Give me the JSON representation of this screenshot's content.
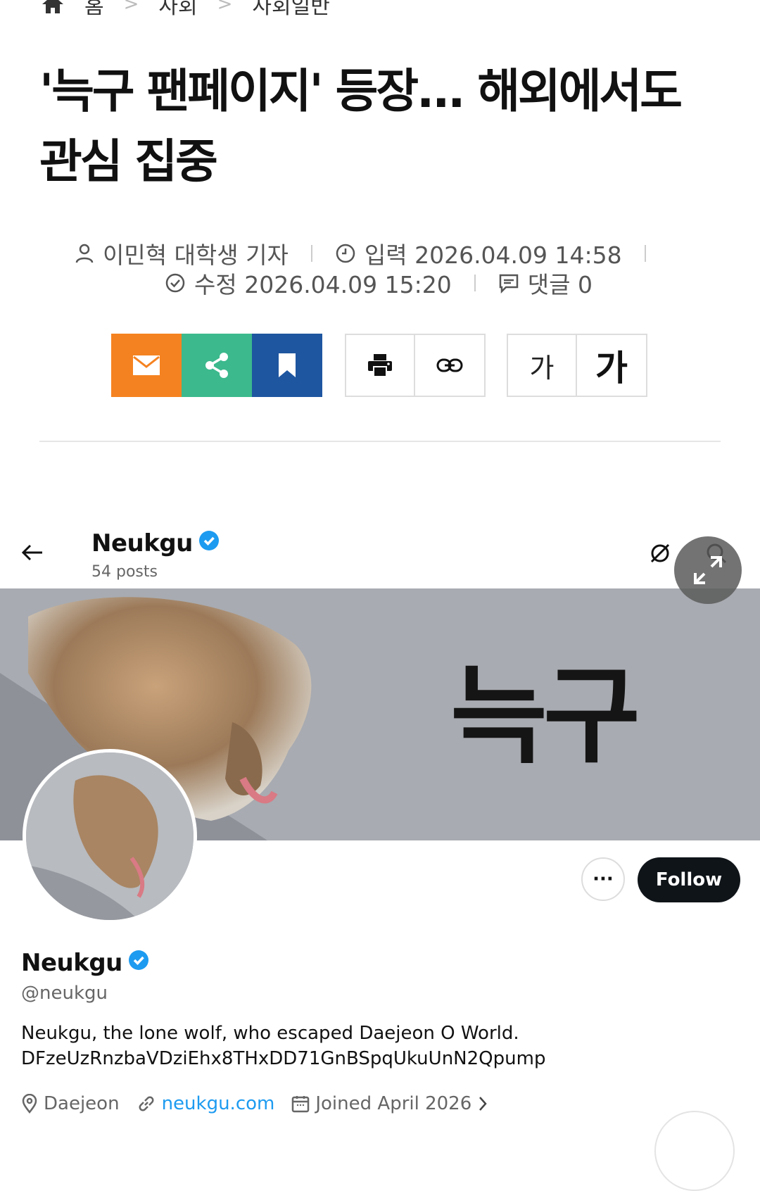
{
  "breadcrumb": {
    "home": "홈",
    "section": "사회",
    "subsection": "사회일반"
  },
  "article": {
    "title_line1": "'늑구 팬페이지' 등장... 해외에서도",
    "title_line2": "관심 집중",
    "author": "이민혁 대학생 기자",
    "input_time": "입력 2026.04.09 14:58",
    "edit_time": "수정 2026.04.09 15:20",
    "comments": "댓글 0"
  },
  "toolbar": {
    "font_small": "가",
    "font_large": "가"
  },
  "colors": {
    "mail": "#f58220",
    "share": "#3cb98d",
    "bookmark": "#1e56a0",
    "twitter_blue": "#1d9bf0"
  },
  "twitter": {
    "header_name": "Neukgu",
    "post_count": "54 posts",
    "banner_text": "늑구",
    "follow": "Follow",
    "more": "···",
    "profile_name": "Neukgu",
    "handle": "@neukgu",
    "bio_line1": "Neukgu, the lone wolf, who escaped Daejeon O World.",
    "bio_line2": "DFzeUzRnzbaVDziEhx8THxDD71GnBSpqUkuUnN2Qpump",
    "location": "Daejeon",
    "website": "neukgu.com",
    "joined": "Joined April 2026"
  }
}
